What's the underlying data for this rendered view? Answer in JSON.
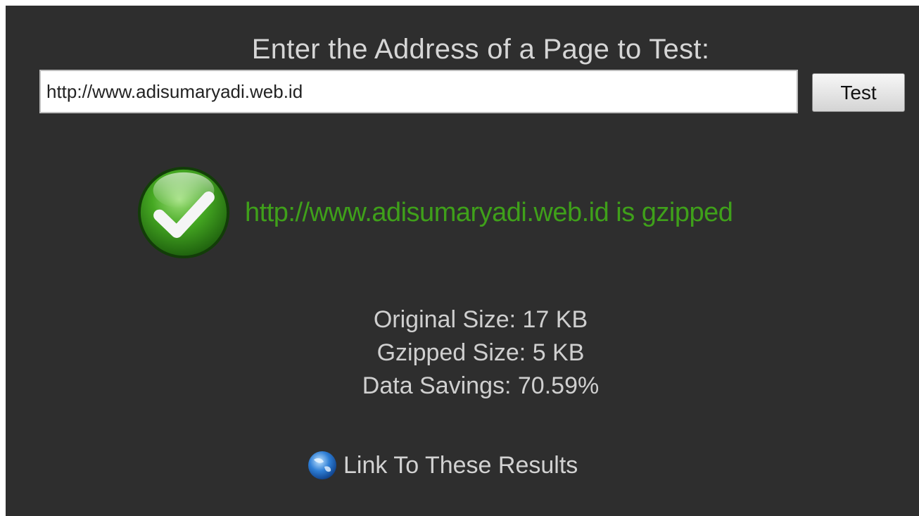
{
  "header": {
    "prompt": "Enter the Address of a Page to Test:"
  },
  "form": {
    "url_value": "http://www.adisumaryadi.web.id",
    "test_label": "Test"
  },
  "result": {
    "status_icon": "check-circle-icon",
    "status_text": "http://www.adisumaryadi.web.id is gzipped",
    "status_color": "#3fa01a"
  },
  "stats": {
    "original_size": "Original Size: 17 KB",
    "gzipped_size": "Gzipped Size: 5 KB",
    "data_savings": "Data Savings: 70.59%"
  },
  "link": {
    "icon": "globe-icon",
    "label": "Link To These Results"
  },
  "colors": {
    "background": "#2e2e2e",
    "success": "#3fa01a",
    "text": "#d6d6d6"
  }
}
